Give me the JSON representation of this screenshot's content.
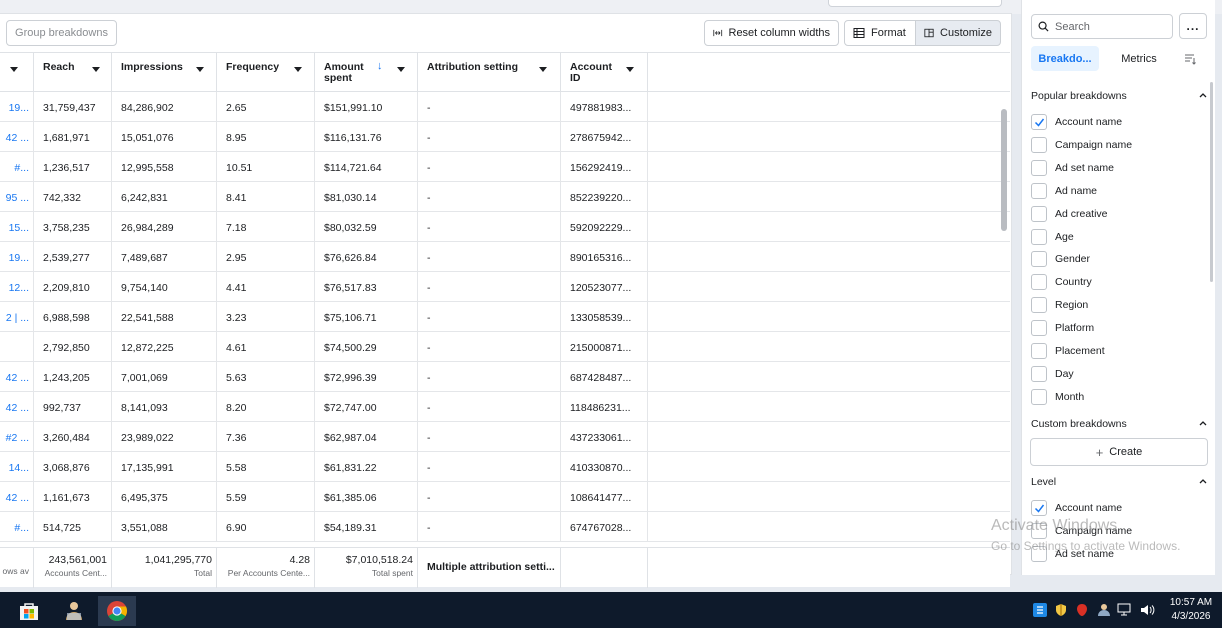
{
  "toolbar": {
    "group_breakdowns": "Group breakdowns",
    "reset_column_widths": "Reset column widths",
    "format": "Format",
    "customize": "Customize"
  },
  "table": {
    "headers": {
      "reach": "Reach",
      "impressions": "Impressions",
      "frequency": "Frequency",
      "amount_spent": "Amount spent",
      "attribution_setting": "Attribution setting",
      "account_id": "Account ID"
    },
    "rows": [
      {
        "name": "19...",
        "reach": "31,759,437",
        "impressions": "84,286,902",
        "frequency": "2.65",
        "amount": "$151,991.10",
        "attribution": "-",
        "account_id": "497881983..."
      },
      {
        "name": "42 ...",
        "reach": "1,681,971",
        "impressions": "15,051,076",
        "frequency": "8.95",
        "amount": "$116,131.76",
        "attribution": "-",
        "account_id": "278675942..."
      },
      {
        "name": "#...",
        "reach": "1,236,517",
        "impressions": "12,995,558",
        "frequency": "10.51",
        "amount": "$114,721.64",
        "attribution": "-",
        "account_id": "156292419..."
      },
      {
        "name": "95 ...",
        "reach": "742,332",
        "impressions": "6,242,831",
        "frequency": "8.41",
        "amount": "$81,030.14",
        "attribution": "-",
        "account_id": "852239220..."
      },
      {
        "name": "15...",
        "reach": "3,758,235",
        "impressions": "26,984,289",
        "frequency": "7.18",
        "amount": "$80,032.59",
        "attribution": "-",
        "account_id": "592092229..."
      },
      {
        "name": "19...",
        "reach": "2,539,277",
        "impressions": "7,489,687",
        "frequency": "2.95",
        "amount": "$76,626.84",
        "attribution": "-",
        "account_id": "890165316..."
      },
      {
        "name": "12...",
        "reach": "2,209,810",
        "impressions": "9,754,140",
        "frequency": "4.41",
        "amount": "$76,517.83",
        "attribution": "-",
        "account_id": "120523077..."
      },
      {
        "name": "2 | ...",
        "reach": "6,988,598",
        "impressions": "22,541,588",
        "frequency": "3.23",
        "amount": "$75,106.71",
        "attribution": "-",
        "account_id": "133058539..."
      },
      {
        "name": "",
        "reach": "2,792,850",
        "impressions": "12,872,225",
        "frequency": "4.61",
        "amount": "$74,500.29",
        "attribution": "-",
        "account_id": "215000871..."
      },
      {
        "name": "42 ...",
        "reach": "1,243,205",
        "impressions": "7,001,069",
        "frequency": "5.63",
        "amount": "$72,996.39",
        "attribution": "-",
        "account_id": "687428487..."
      },
      {
        "name": "42 ...",
        "reach": "992,737",
        "impressions": "8,141,093",
        "frequency": "8.20",
        "amount": "$72,747.00",
        "attribution": "-",
        "account_id": "118486231..."
      },
      {
        "name": "#2 ...",
        "reach": "3,260,484",
        "impressions": "23,989,022",
        "frequency": "7.36",
        "amount": "$62,987.04",
        "attribution": "-",
        "account_id": "437233061..."
      },
      {
        "name": "14...",
        "reach": "3,068,876",
        "impressions": "17,135,991",
        "frequency": "5.58",
        "amount": "$61,831.22",
        "attribution": "-",
        "account_id": "410330870..."
      },
      {
        "name": "42 ...",
        "reach": "1,161,673",
        "impressions": "6,495,375",
        "frequency": "5.59",
        "amount": "$61,385.06",
        "attribution": "-",
        "account_id": "108641477..."
      },
      {
        "name": "#...",
        "reach": "514,725",
        "impressions": "3,551,088",
        "frequency": "6.90",
        "amount": "$54,189.31",
        "attribution": "-",
        "account_id": "674767028..."
      }
    ],
    "footer": {
      "name_sub": "ows av",
      "reach": "243,561,001",
      "reach_sub": "Accounts Cent...",
      "impressions": "1,041,295,770",
      "impressions_sub": "Total",
      "frequency": "4.28",
      "frequency_sub": "Per Accounts Cente...",
      "amount": "$7,010,518.24",
      "amount_sub": "Total spent",
      "attribution": "Multiple attribution setti..."
    }
  },
  "panel": {
    "search_placeholder": "Search",
    "more": "...",
    "tab_breakdowns": "Breakdo...",
    "tab_metrics": "Metrics",
    "popular_title": "Popular breakdowns",
    "popular": [
      {
        "label": "Account name",
        "checked": true
      },
      {
        "label": "Campaign name",
        "checked": false
      },
      {
        "label": "Ad set name",
        "checked": false
      },
      {
        "label": "Ad name",
        "checked": false
      },
      {
        "label": "Ad creative",
        "checked": false
      },
      {
        "label": "Age",
        "checked": false
      },
      {
        "label": "Gender",
        "checked": false
      },
      {
        "label": "Country",
        "checked": false
      },
      {
        "label": "Region",
        "checked": false
      },
      {
        "label": "Platform",
        "checked": false
      },
      {
        "label": "Placement",
        "checked": false
      },
      {
        "label": "Day",
        "checked": false
      },
      {
        "label": "Month",
        "checked": false
      }
    ],
    "custom_title": "Custom breakdowns",
    "create": "Create",
    "level_title": "Level",
    "level": [
      {
        "label": "Account name",
        "checked": true
      },
      {
        "label": "Campaign name",
        "checked": false
      },
      {
        "label": "Ad set name",
        "checked": false
      }
    ]
  },
  "watermark": {
    "line1": "Activate Windows",
    "line2": "Go to Settings to activate Windows."
  },
  "taskbar": {
    "time": "10:57 AM",
    "date": "4/3/2026"
  },
  "colors": {
    "link": "#1877f2",
    "checkmark": "#1877f2",
    "taskbar": "#0e1a2b"
  }
}
